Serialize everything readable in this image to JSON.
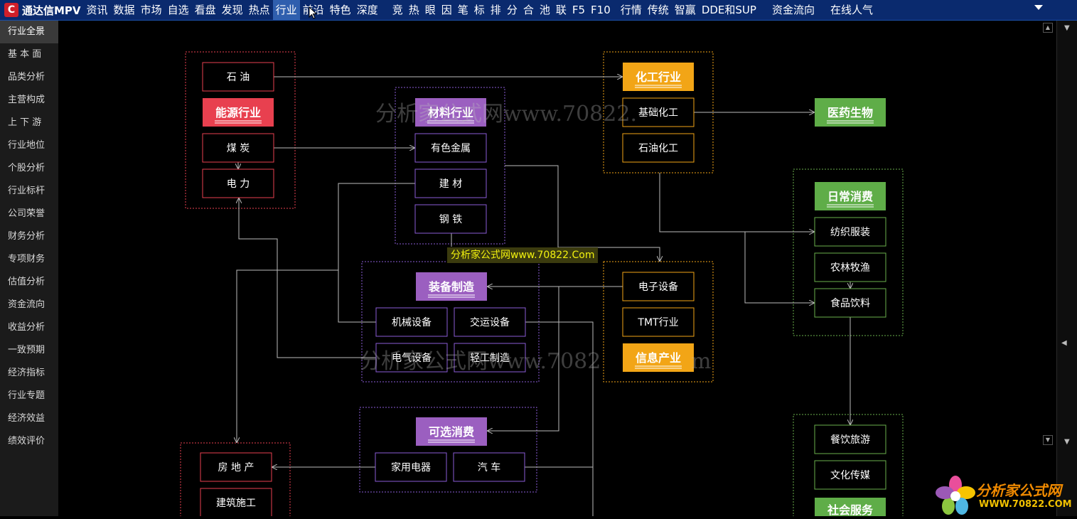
{
  "app": {
    "logo_letter": "C",
    "title": "通达信MPV"
  },
  "menu": [
    "资讯",
    "数据",
    "市场",
    "自选",
    "看盘",
    "发现",
    "热点",
    "行业",
    "前沿",
    "特色",
    "深度",
    "竞",
    "热",
    "眼",
    "因",
    "笔",
    "标",
    "排",
    "分",
    "合",
    "池",
    "联",
    "F5",
    "F10",
    "行情",
    "传统",
    "智赢",
    "DDE和SUP",
    "资金流向",
    "在线人气"
  ],
  "menu_active": "行业",
  "sidebar": [
    "行业全景",
    "基 本 面",
    "品类分析",
    "主营构成",
    "上 下 游",
    "行业地位",
    "个股分析",
    "行业标杆",
    "公司荣誉",
    "财务分析",
    "专项财务",
    "估值分析",
    "资金流向",
    "收益分析",
    "一致预期",
    "经济指标",
    "行业专题",
    "经济效益",
    "绩效评价"
  ],
  "sidebar_active": "行业全景",
  "colors": {
    "energy": "#e8404f",
    "material": "#9b5fc0",
    "chem": "#f2a516",
    "consumer": "#5fad48",
    "red_border": "#e8404f",
    "purple_border": "#8a5bd6",
    "orange_border": "#f2a516",
    "green_border": "#6ab04c"
  },
  "diagram": {
    "groups": {
      "energy": {
        "title": "能源行业",
        "items": [
          "石  油",
          "煤    炭",
          "电    力"
        ]
      },
      "material": {
        "title": "材料行业",
        "items": [
          "有色金属",
          "建    材",
          "钢    铁"
        ]
      },
      "chem": {
        "title": "化工行业",
        "items": [
          "基础化工",
          "石油化工"
        ]
      },
      "pharma": {
        "title": "医药生物"
      },
      "daily": {
        "title": "日常消费",
        "items": [
          "纺织服装",
          "农林牧渔",
          "食品饮料"
        ]
      },
      "equipment": {
        "title": "装备制造",
        "items": [
          "机械设备",
          "交运设备",
          "电气设备",
          "轻工制造"
        ]
      },
      "info": {
        "title": "信息产业",
        "items": [
          "电子设备",
          "TMT行业"
        ]
      },
      "optional": {
        "title": "可选消费",
        "items": [
          "家用电器",
          "汽    车"
        ]
      },
      "realestate": {
        "items": [
          "房 地 产",
          "建筑施工"
        ]
      },
      "service": {
        "title": "社会服务",
        "items": [
          "餐饮旅游",
          "文化传媒"
        ]
      }
    }
  },
  "watermark": {
    "big_1": "分析家公式网www.70822.",
    "big_2": "分析家公式网www.7082",
    "big_2_tail": "m",
    "label": "分析家公式网www.70822.Com"
  },
  "brand": {
    "name": "分析家公式网",
    "url": "WWW.70822.COM"
  }
}
